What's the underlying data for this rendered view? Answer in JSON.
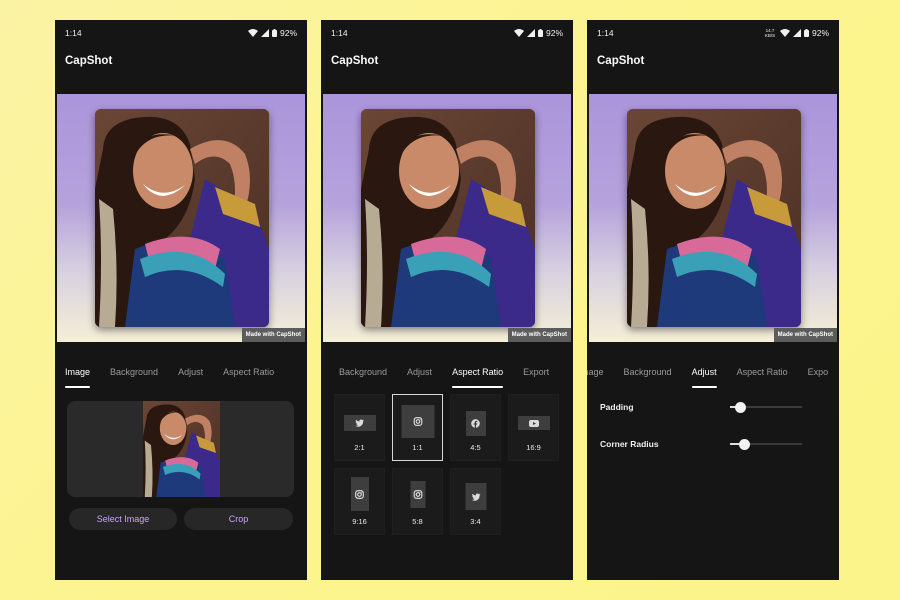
{
  "screens": [
    {
      "status": {
        "time": "1:14",
        "battery": "92%"
      },
      "app_title": "CapShot",
      "watermark": "Made with CapShot",
      "tabs": [
        {
          "label": "Image",
          "active": true
        },
        {
          "label": "Background",
          "active": false
        },
        {
          "label": "Adjust",
          "active": false
        },
        {
          "label": "Aspect Ratio",
          "active": false
        }
      ],
      "buttons": {
        "select_image": "Select Image",
        "crop": "Crop"
      }
    },
    {
      "status": {
        "time": "1:14",
        "battery": "92%"
      },
      "app_title": "CapShot",
      "watermark": "Made with CapShot",
      "tabs": [
        {
          "label": "Background",
          "active": false
        },
        {
          "label": "Adjust",
          "active": false
        },
        {
          "label": "Aspect Ratio",
          "active": true
        },
        {
          "label": "Export",
          "active": false
        }
      ],
      "ratios": [
        {
          "label": "2:1",
          "icon": "twitter-icon",
          "selected": false
        },
        {
          "label": "1:1",
          "icon": "instagram-icon",
          "selected": true
        },
        {
          "label": "4:5",
          "icon": "facebook-icon",
          "selected": false
        },
        {
          "label": "16:9",
          "icon": "youtube-icon",
          "selected": false
        },
        {
          "label": "9:16",
          "icon": "instagram-icon",
          "selected": false
        },
        {
          "label": "5:8",
          "icon": "instagram-icon",
          "selected": false
        },
        {
          "label": "3:4",
          "icon": "twitter-icon",
          "selected": false
        }
      ]
    },
    {
      "status": {
        "time": "1:14",
        "net_speed": "14.7 KB/S",
        "battery": "92%"
      },
      "app_title": "CapShot",
      "watermark": "Made with CapShot",
      "tabs": [
        {
          "label": "mage",
          "active": false
        },
        {
          "label": "Background",
          "active": false
        },
        {
          "label": "Adjust",
          "active": true
        },
        {
          "label": "Aspect Ratio",
          "active": false
        },
        {
          "label": "Expo",
          "active": false
        }
      ],
      "settings": [
        {
          "label": "Padding",
          "value_fraction": 0.15
        },
        {
          "label": "Corner Radius",
          "value_fraction": 0.2
        }
      ]
    }
  ],
  "colors": {
    "backdrop": "#fcf48e",
    "phone_bg": "#151515",
    "accent_purple": "#c9a4f5",
    "preview_top": "#ab95db",
    "preview_bottom": "#f4efd6"
  }
}
